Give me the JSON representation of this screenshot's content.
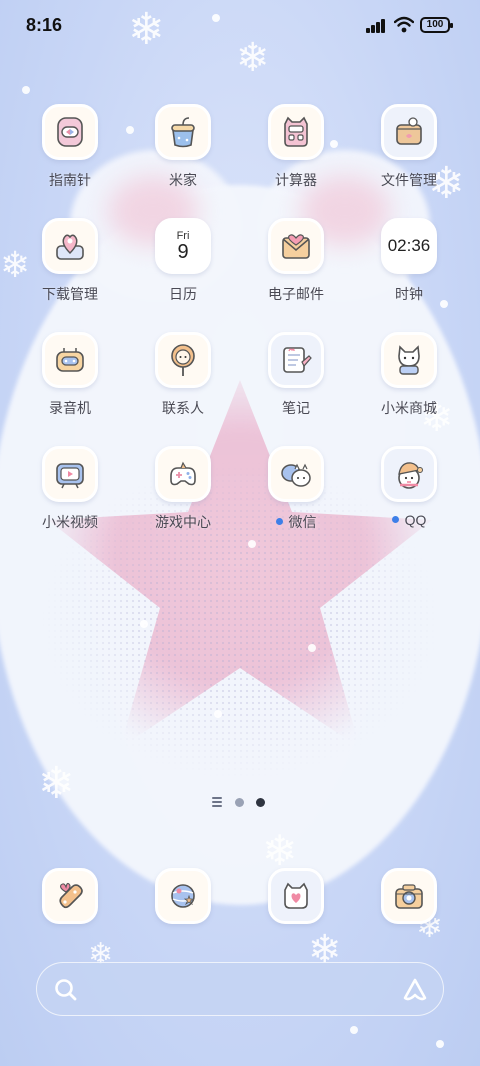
{
  "status_bar": {
    "time": "8:16",
    "battery": "100"
  },
  "apps": [
    {
      "label": "指南针",
      "icon": "compass-icon",
      "dot": false
    },
    {
      "label": "米家",
      "icon": "mijia-icon",
      "dot": false
    },
    {
      "label": "计算器",
      "icon": "calculator-icon",
      "dot": false
    },
    {
      "label": "文件管理",
      "icon": "file-manager-icon",
      "dot": false
    },
    {
      "label": "下载管理",
      "icon": "download-manager-icon",
      "dot": false
    },
    {
      "label": "日历",
      "icon": "calendar-icon",
      "dot": false
    },
    {
      "label": "电子邮件",
      "icon": "email-icon",
      "dot": false
    },
    {
      "label": "时钟",
      "icon": "clock-icon",
      "dot": false
    },
    {
      "label": "录音机",
      "icon": "recorder-icon",
      "dot": false
    },
    {
      "label": "联系人",
      "icon": "contacts-icon",
      "dot": false
    },
    {
      "label": "笔记",
      "icon": "notes-icon",
      "dot": false
    },
    {
      "label": "小米商城",
      "icon": "mi-store-icon",
      "dot": false
    },
    {
      "label": "小米视频",
      "icon": "mi-video-icon",
      "dot": false
    },
    {
      "label": "游戏中心",
      "icon": "game-center-icon",
      "dot": false
    },
    {
      "label": "微信",
      "icon": "wechat-icon",
      "dot": true
    },
    {
      "label": "QQ",
      "icon": "qq-icon",
      "dot": true
    }
  ],
  "calendar": {
    "weekday": "Fri",
    "day": "9"
  },
  "clock": {
    "time": "02:36"
  },
  "pager": {
    "pages": 2,
    "current": 2
  },
  "dock": [
    {
      "icon": "phone-icon"
    },
    {
      "icon": "browser-icon"
    },
    {
      "icon": "messages-icon"
    },
    {
      "icon": "camera-icon"
    }
  ],
  "colors": {
    "accent_dot": "#3d7fe8",
    "tile_bg": "#fffaf3"
  }
}
